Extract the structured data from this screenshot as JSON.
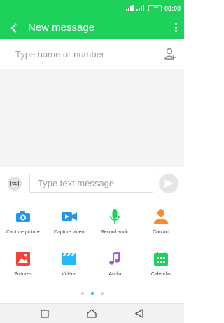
{
  "status_bar": {
    "battery": "100",
    "time": "08:00"
  },
  "app_bar": {
    "title": "New message",
    "back_icon": "arrow-left-icon",
    "more_icon": "more-vert-icon"
  },
  "recipient": {
    "placeholder": "Type name or number",
    "icon": "add-contact-icon"
  },
  "compose": {
    "placeholder": "Type text message",
    "keyboard_icon": "keyboard-icon",
    "send_icon": "send-icon"
  },
  "attachments": [
    {
      "label": "Capture picture",
      "icon": "camera-icon",
      "color": "#2196f3"
    },
    {
      "label": "Capture video",
      "icon": "video-camera-icon",
      "color": "#2196f3"
    },
    {
      "label": "Record audio",
      "icon": "microphone-icon",
      "color": "#1ed15a"
    },
    {
      "label": "Contact",
      "icon": "person-icon",
      "color": "#ff8a2a"
    },
    {
      "label": "Pictures",
      "icon": "image-icon",
      "color": "#f44336"
    },
    {
      "label": "Videos",
      "icon": "clapperboard-icon",
      "color": "#29b6f6"
    },
    {
      "label": "Audio",
      "icon": "music-note-icon",
      "color": "#a35ce0"
    },
    {
      "label": "Calendar",
      "icon": "calendar-icon",
      "color": "#1ed15a"
    }
  ],
  "pager": {
    "pages": 3,
    "active": 1
  },
  "colors": {
    "accent": "#1ed15a",
    "placeholder_gray": "#9e9e9e"
  },
  "nav_bar": [
    "square-icon",
    "home-icon",
    "back-triangle-icon"
  ]
}
